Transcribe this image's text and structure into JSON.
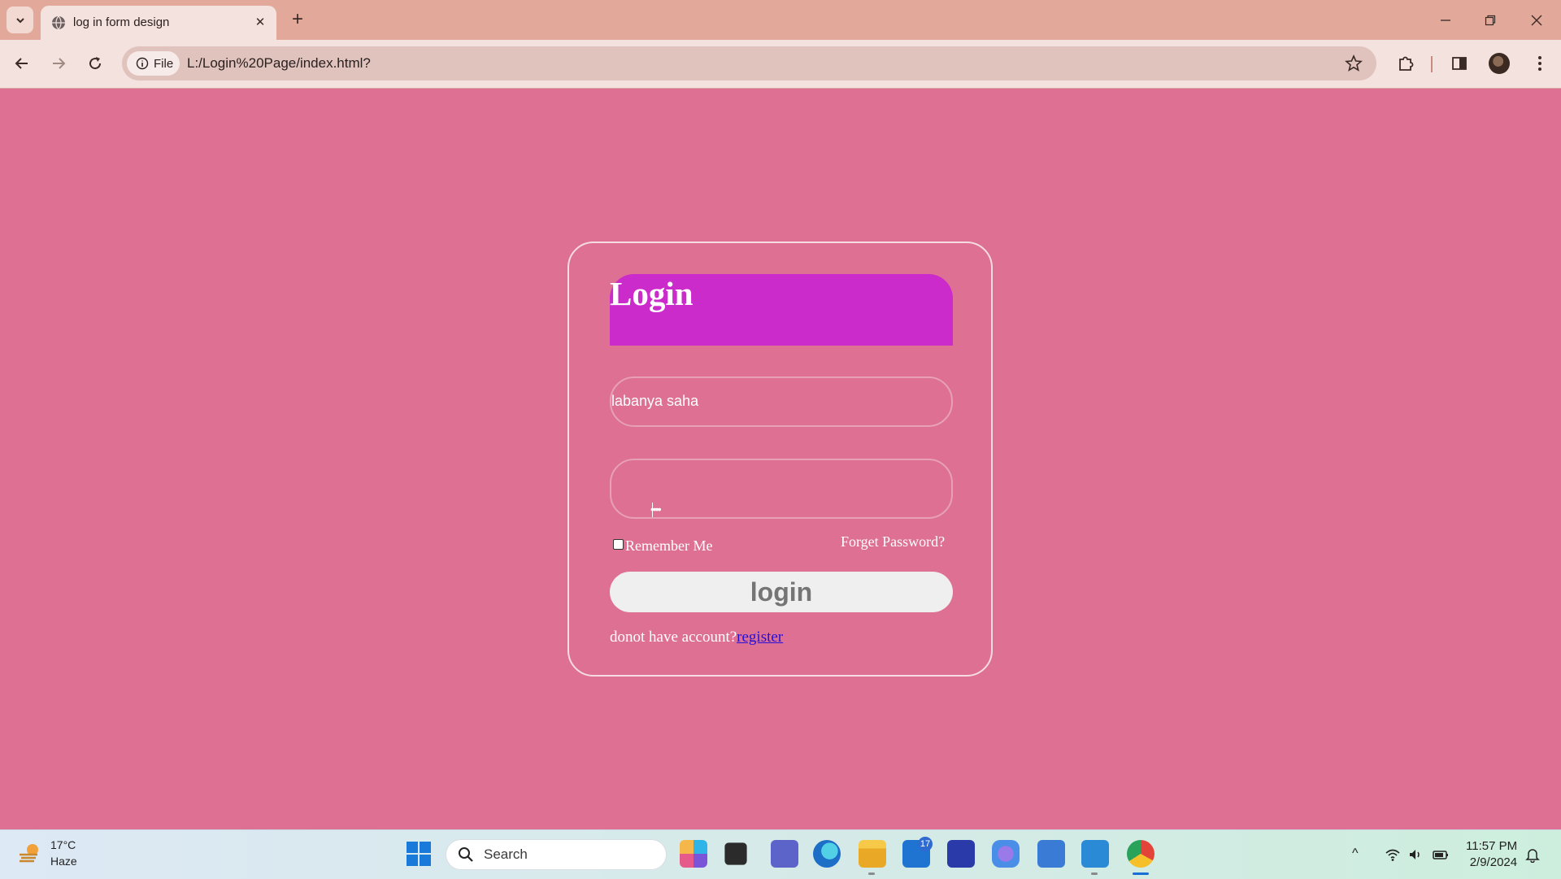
{
  "browser": {
    "tab_title": "log in form design",
    "site_chip": "File",
    "url": "L:/Login%20Page/index.html?"
  },
  "form": {
    "title": "Login",
    "username_value": "labanya saha",
    "password_masked": "••••",
    "remember_label": "Remember Me",
    "remember_checked": false,
    "forget_label": "Forget Password?",
    "login_button": "login",
    "register_prompt": "donot have account?",
    "register_link": "register"
  },
  "taskbar": {
    "weather_temp": "17°C",
    "weather_desc": "Haze",
    "search_label": "Search",
    "mail_badge": "17",
    "time": "11:57 PM",
    "date": "2/9/2024"
  },
  "colors": {
    "page_bg": "#dd7093",
    "header_bg": "#cc2bcc",
    "link": "#2410d8"
  }
}
